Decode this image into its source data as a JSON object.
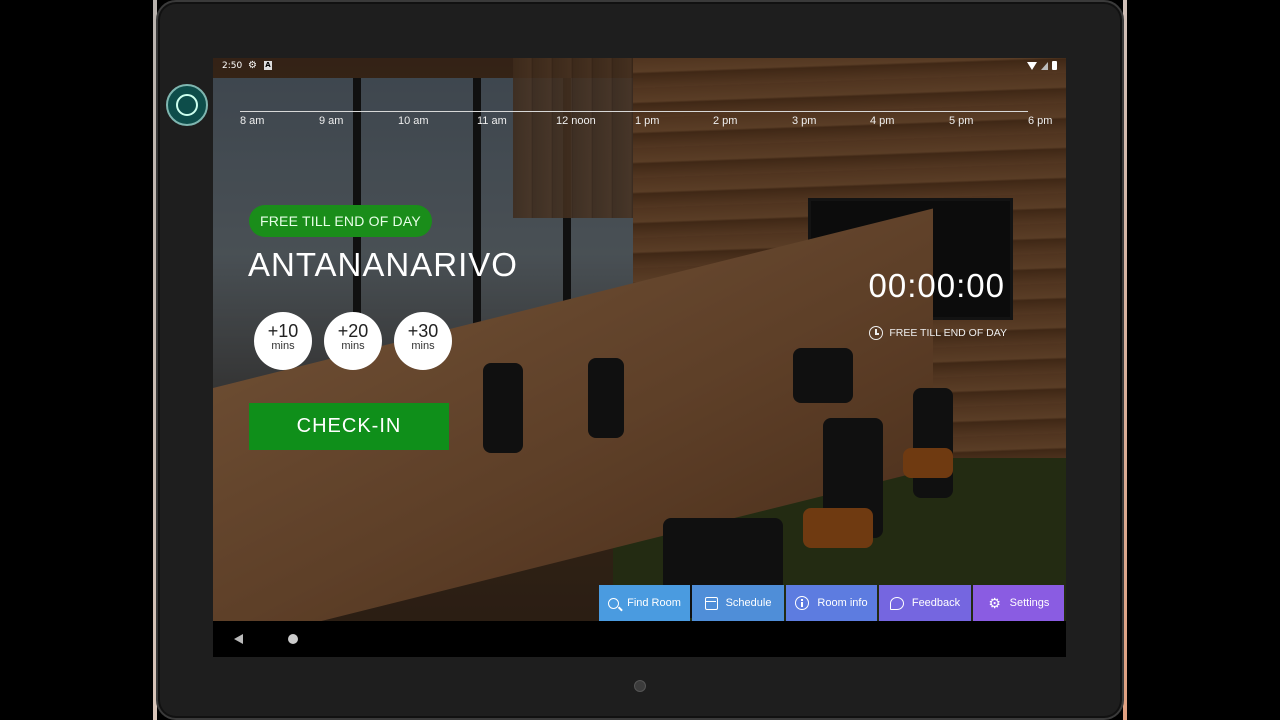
{
  "status_bar": {
    "time": "2:50",
    "a_icon_letter": "A"
  },
  "timeline": {
    "ticks": [
      "8 am",
      "9 am",
      "10 am",
      "11 am",
      "12 noon",
      "1 pm",
      "2 pm",
      "3 pm",
      "4 pm",
      "5 pm",
      "6 pm"
    ]
  },
  "room": {
    "status_badge": "FREE TILL END OF DAY",
    "name": "ANTANANARIVO",
    "extensions": [
      {
        "value": "+10",
        "unit": "mins"
      },
      {
        "value": "+20",
        "unit": "mins"
      },
      {
        "value": "+30",
        "unit": "mins"
      }
    ],
    "checkin_label": "CHECK-IN"
  },
  "timer": {
    "value": "00:00:00",
    "status": "FREE TILL END OF DAY"
  },
  "menu": {
    "items": [
      {
        "label": "Find Room",
        "icon": "search-icon",
        "color": "#4a9be0"
      },
      {
        "label": "Schedule",
        "icon": "calendar-icon",
        "color": "#4f8ed8"
      },
      {
        "label": "Room info",
        "icon": "info-icon",
        "color": "#5d7ce0"
      },
      {
        "label": "Feedback",
        "icon": "chat-icon",
        "color": "#7566e0"
      },
      {
        "label": "Settings",
        "icon": "gear-icon",
        "color": "#8a5ce2"
      }
    ]
  },
  "colors": {
    "free_green": "#1a8d1a",
    "checkin_green": "#0f8f1a"
  }
}
